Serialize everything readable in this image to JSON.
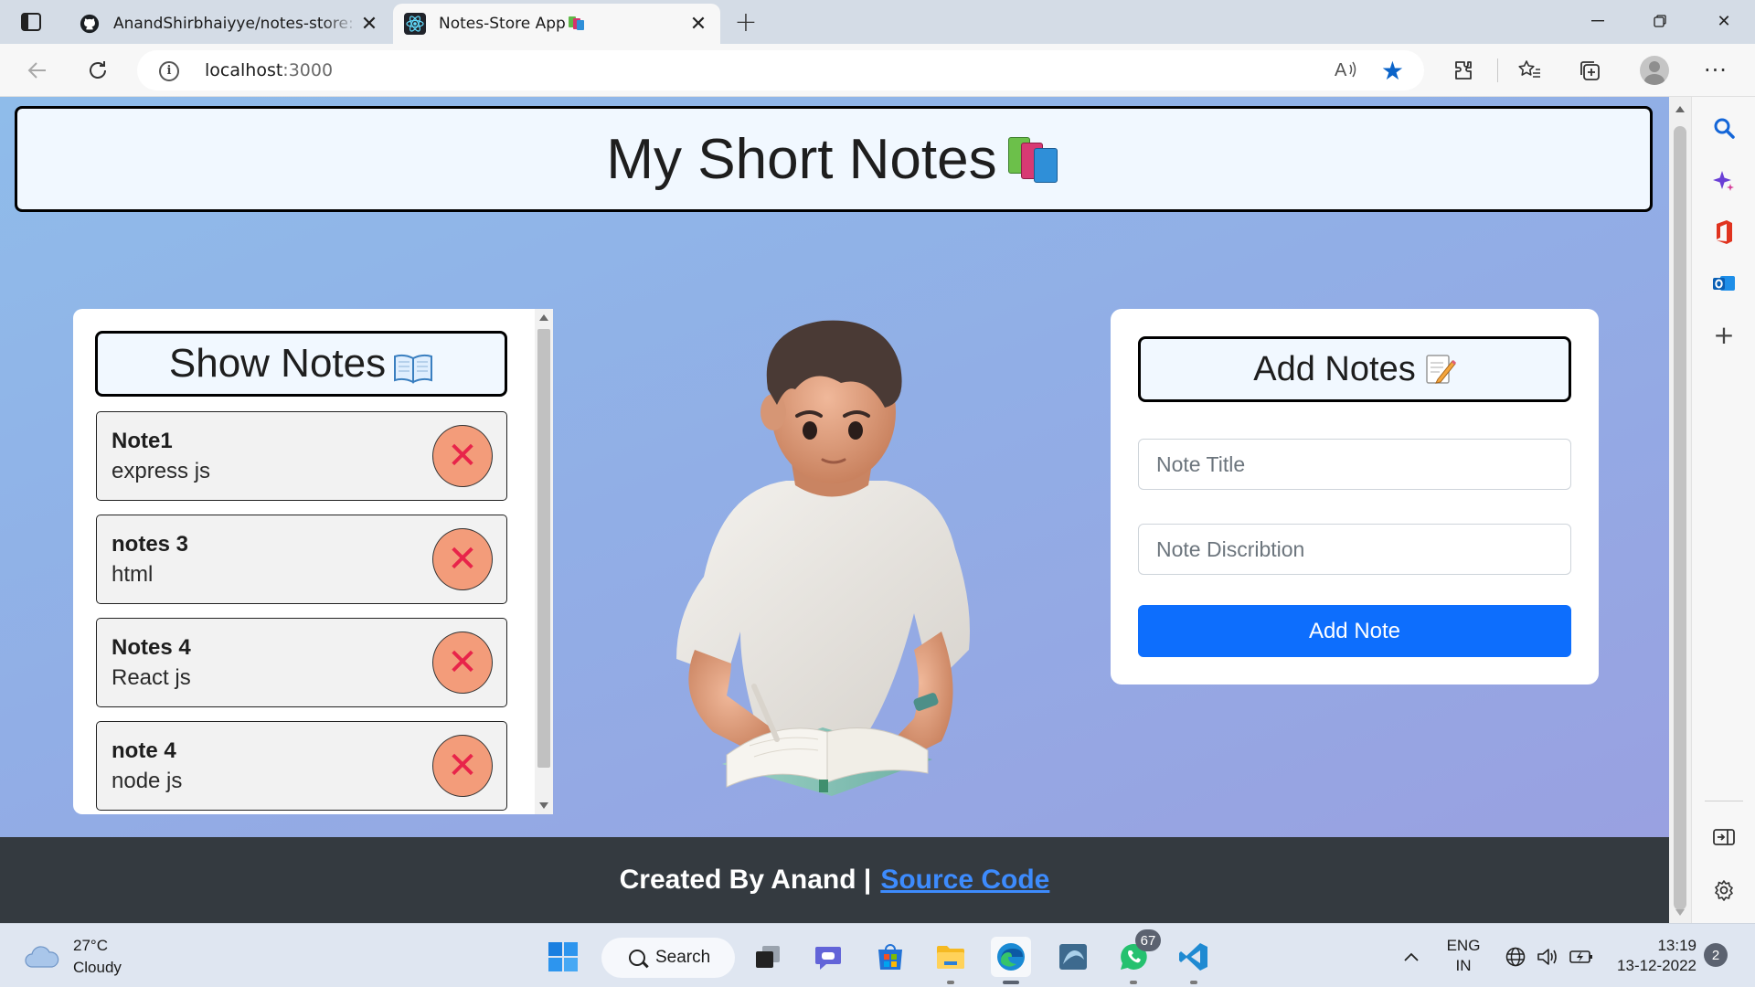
{
  "browser": {
    "tabs": [
      {
        "title": "AnandShirbhaiyye/notes-store: n",
        "favicon": "github-icon",
        "active": false
      },
      {
        "title": "Notes-Store App",
        "favicon": "react-icon",
        "active": true
      }
    ],
    "address": {
      "host": "localhost",
      "port": ":3000"
    },
    "read_aloud_label": "A ̩⁴"
  },
  "page": {
    "header_title": "My Short Notes",
    "show_notes": {
      "heading": "Show Notes",
      "notes": [
        {
          "title": "Note1",
          "description": "express js"
        },
        {
          "title": "notes 3",
          "description": "html"
        },
        {
          "title": "Notes 4",
          "description": "React js"
        },
        {
          "title": "note 4",
          "description": "node js"
        }
      ],
      "delete_glyph": "✕"
    },
    "add_notes": {
      "heading": "Add Notes",
      "title_placeholder": "Note Title",
      "desc_placeholder": "Note Discribtion",
      "button_label": "Add Note"
    },
    "footer": {
      "text": "Created By Anand |",
      "link_text": "Source Code"
    }
  },
  "taskbar": {
    "weather": {
      "temp": "27°C",
      "condition": "Cloudy"
    },
    "search_label": "Search",
    "whatsapp_badge": "67",
    "language": {
      "line1": "ENG",
      "line2": "IN"
    },
    "clock": {
      "time": "13:19",
      "date": "13-12-2022"
    },
    "notification_count": "2"
  },
  "colors": {
    "page_gradient_start": "#8fbcea",
    "page_gradient_end": "#9a9fe0",
    "primary_button": "#0d6efd",
    "footer_bg": "#343a40",
    "delete_button": "#f39c7a",
    "delete_x": "#e8244a"
  }
}
